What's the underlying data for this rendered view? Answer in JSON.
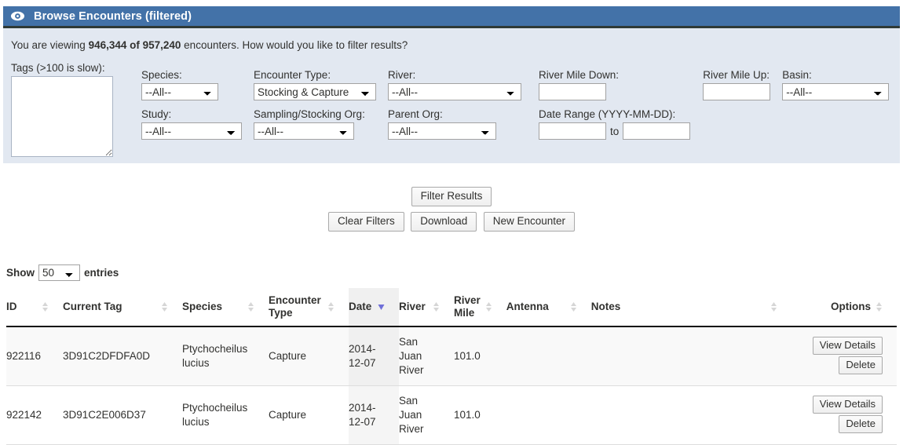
{
  "window": {
    "title": "Browse Encounters (filtered)",
    "icon": "eye-icon",
    "header_bg": "#4372a8",
    "panel_bg": "#e2e8f1"
  },
  "summary": {
    "prefix": "You are viewing ",
    "counts": "946,344 of 957,240",
    "suffix": " encounters. How would you like to filter results?"
  },
  "filters": {
    "tags_label": "Tags (>100 is slow):",
    "tags_value": "",
    "species_label": "Species:",
    "species_value": "--All--",
    "study_label": "Study:",
    "study_value": "--All--",
    "encounter_type_label": "Encounter Type:",
    "encounter_type_value": "Stocking & Capture",
    "sampling_org_label": "Sampling/Stocking Org:",
    "sampling_org_value": "--All--",
    "river_label": "River:",
    "river_value": "--All--",
    "parent_org_label": "Parent Org:",
    "parent_org_value": "--All--",
    "river_mile_down_label": "River Mile Down:",
    "river_mile_down_value": "",
    "date_range_label": "Date Range (YYYY-MM-DD):",
    "date_from_value": "",
    "date_to_word": "to",
    "date_to_value": "",
    "river_mile_up_label": "River Mile Up:",
    "river_mile_up_value": "",
    "basin_label": "Basin:",
    "basin_value": "--All--"
  },
  "actions": {
    "filter_results": "Filter Results",
    "clear_filters": "Clear Filters",
    "download": "Download",
    "new_encounter": "New Encounter"
  },
  "length_menu": {
    "show": "Show",
    "value": "50",
    "entries": "entries"
  },
  "table": {
    "columns": [
      {
        "label": "ID",
        "sort": "both"
      },
      {
        "label": "Current Tag",
        "sort": "both"
      },
      {
        "label": "Species",
        "sort": "both"
      },
      {
        "label": "Encounter Type",
        "sort": "both"
      },
      {
        "label": "Date",
        "sort": "desc"
      },
      {
        "label": "River",
        "sort": "both"
      },
      {
        "label": "River Mile",
        "sort": "both"
      },
      {
        "label": "Antenna",
        "sort": "both"
      },
      {
        "label": "Notes",
        "sort": "both"
      },
      {
        "label": "Options",
        "sort": "both"
      }
    ],
    "rows": [
      {
        "id": "922116",
        "current_tag": "3D91C2DFDFA0D",
        "species": "Ptychocheilus lucius",
        "encounter_type": "Capture",
        "date": "2014-12-07",
        "river": "San Juan River",
        "river_mile": "101.0",
        "antenna": "",
        "notes": "",
        "view_details": "View Details",
        "delete": "Delete"
      },
      {
        "id": "922142",
        "current_tag": "3D91C2E006D37",
        "species": "Ptychocheilus lucius",
        "encounter_type": "Capture",
        "date": "2014-12-07",
        "river": "San Juan River",
        "river_mile": "101.0",
        "antenna": "",
        "notes": "",
        "view_details": "View Details",
        "delete": "Delete"
      }
    ]
  }
}
